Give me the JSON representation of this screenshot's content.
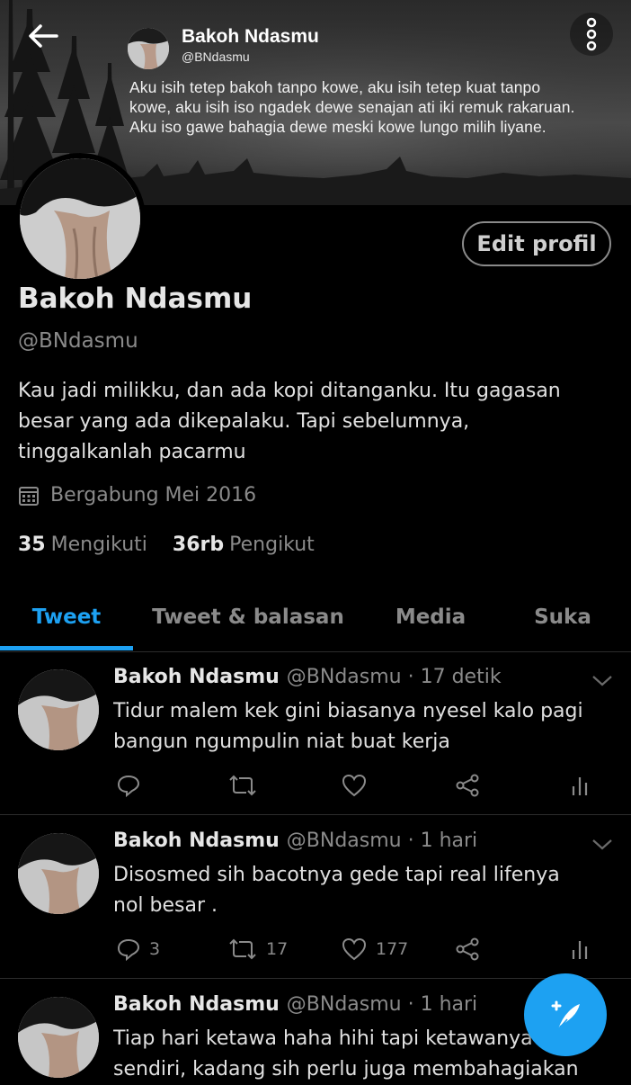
{
  "header": {
    "name": "Bakoh Ndasmu",
    "handle": "@BNdasmu",
    "banner_text": "Aku isih tetep bakoh tanpo kowe, aku isih tetep kuat tanpo kowe, aku isih iso ngadek dewe senajan ati iki remuk rakaruan. Aku iso gawe bahagia dewe meski kowe lungo milih liyane."
  },
  "profile": {
    "edit_label": "Edit profil",
    "name": "Bakoh Ndasmu",
    "handle": "@BNdasmu",
    "bio": "Kau jadi milikku, dan ada kopi ditanganku. Itu gagasan besar yang ada dikepalaku. Tapi sebelumnya, tinggalkanlah pacarmu",
    "joined": "Bergabung Mei 2016",
    "following_count": "35",
    "following_label": "Mengikuti",
    "followers_count": "36rb",
    "followers_label": "Pengikut"
  },
  "tabs": [
    {
      "label": "Tweet",
      "active": true
    },
    {
      "label": "Tweet & balasan",
      "active": false
    },
    {
      "label": "Media",
      "active": false
    },
    {
      "label": "Suka",
      "active": false
    }
  ],
  "tweets": [
    {
      "name": "Bakoh Ndasmu",
      "handle": "@BNdasmu · 17 detik",
      "line1": "Tidur malem kek gini biasanya nyesel kalo pagi",
      "line2": "bangun ngumpulin niat buat kerja",
      "replies": "",
      "retweets": "",
      "likes": ""
    },
    {
      "name": "Bakoh Ndasmu",
      "handle": "@BNdasmu · 1 hari",
      "line1": "Disosmed sih bacotnya gede tapi real lifenya",
      "line2": "nol besar .",
      "replies": "3",
      "retweets": "17",
      "likes": "177"
    },
    {
      "name": "Bakoh Ndasmu",
      "handle": "@BNdasmu · 1 hari",
      "line1": "Tiap hari ketawa haha hihi tapi ketawanya",
      "line2": "sendiri, kadang sih perlu juga membahagiakan"
    }
  ],
  "icons": {
    "back": "arrow-left-icon",
    "menu": "more-vertical-icon",
    "calendar": "calendar-icon",
    "reply": "reply-icon",
    "retweet": "retweet-icon",
    "like": "heart-icon",
    "share": "share-icon",
    "analytics": "analytics-icon",
    "compose": "compose-tweet-icon"
  },
  "colors": {
    "accent": "#1da1f2",
    "background": "#000000",
    "secondary_text": "#8a8a8a"
  }
}
